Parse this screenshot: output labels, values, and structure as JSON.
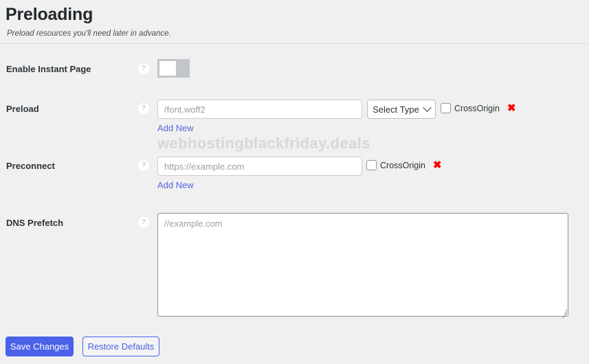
{
  "header": {
    "title": "Preloading",
    "subtitle": "Preload resources you'll need later in advance."
  },
  "help_icon_glyph": "?",
  "rows": {
    "instant_page": {
      "label": "Enable Instant Page",
      "toggle_state": "off"
    },
    "preload": {
      "label": "Preload",
      "input_placeholder": "/font.woff2",
      "input_value": "",
      "select_label": "Select Type",
      "crossorigin_label": "CrossOrigin",
      "crossorigin_checked": false,
      "delete_glyph": "✖",
      "add_new_label": "Add New"
    },
    "preconnect": {
      "label": "Preconnect",
      "input_placeholder": "https://example.com",
      "input_value": "",
      "crossorigin_label": "CrossOrigin",
      "crossorigin_checked": false,
      "delete_glyph": "✖",
      "add_new_label": "Add New"
    },
    "dns_prefetch": {
      "label": "DNS Prefetch",
      "textarea_placeholder": "//example.com",
      "textarea_value": ""
    }
  },
  "watermark": "webhostingblackfriday.deals",
  "footer": {
    "save_label": "Save Changes",
    "restore_label": "Restore Defaults"
  },
  "colors": {
    "accent": "#4a61e8",
    "link": "#5566e0",
    "danger": "#ff0000",
    "background": "#f0f0f0"
  }
}
